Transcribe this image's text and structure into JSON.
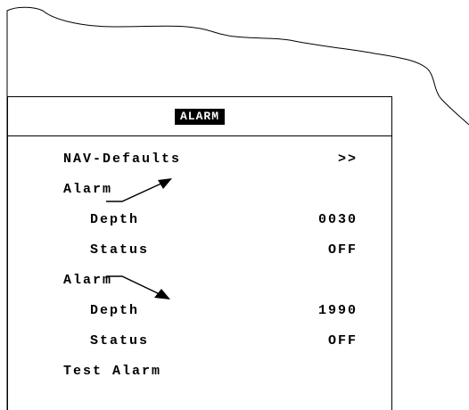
{
  "window": {
    "title": "ALARM"
  },
  "menu": {
    "items": [
      {
        "label": "NAV-Defaults",
        "value": ">>"
      },
      {
        "label": "Alarm",
        "icon": "arrow-up-right-icon"
      },
      {
        "label": "Depth",
        "value": "0030"
      },
      {
        "label": "Status",
        "value": "OFF"
      },
      {
        "label": "Alarm",
        "icon": "arrow-down-right-icon"
      },
      {
        "label": "Depth",
        "value": "1990"
      },
      {
        "label": "Status",
        "value": "OFF"
      },
      {
        "label": "Test Alarm"
      }
    ]
  },
  "colors": {
    "foreground": "#000000",
    "background": "#ffffff",
    "title_bg": "#000000",
    "title_fg": "#ffffff"
  }
}
